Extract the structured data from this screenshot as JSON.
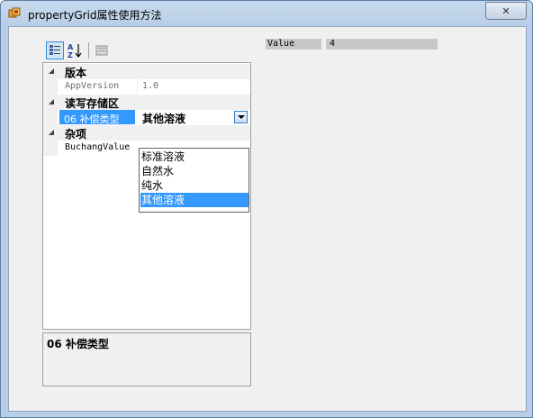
{
  "window": {
    "title": "propertyGrid属性使用方法",
    "close_label": "✕"
  },
  "property_grid": {
    "toolbar": {
      "categorized_icon": "categorized-icon",
      "alphabetical_icon": "alphabetical-icon",
      "alphabetical_label": "A Z",
      "pages_icon": "property-pages-icon"
    },
    "categories": [
      {
        "name": "版本",
        "properties": [
          {
            "name": "AppVersion",
            "value": "1.0",
            "readonly": true
          }
        ]
      },
      {
        "name": "读写存储区",
        "properties": [
          {
            "name": "06 补偿类型",
            "value": "其他溶液",
            "selected": true
          }
        ]
      },
      {
        "name": "杂项",
        "properties": [
          {
            "name": "BuchangValue",
            "value": ""
          }
        ]
      }
    ],
    "dropdown": {
      "options": [
        "标准溶液",
        "自然水",
        "纯水",
        "其他溶液"
      ],
      "selected": "其他溶液"
    },
    "description": {
      "title": "06  补偿类型"
    }
  },
  "value_display": {
    "label": "Value",
    "value": "4"
  },
  "colors": {
    "selection": "#3399ff",
    "category_bg": "#f0f0f0",
    "window_frame": "#b8cde6"
  }
}
